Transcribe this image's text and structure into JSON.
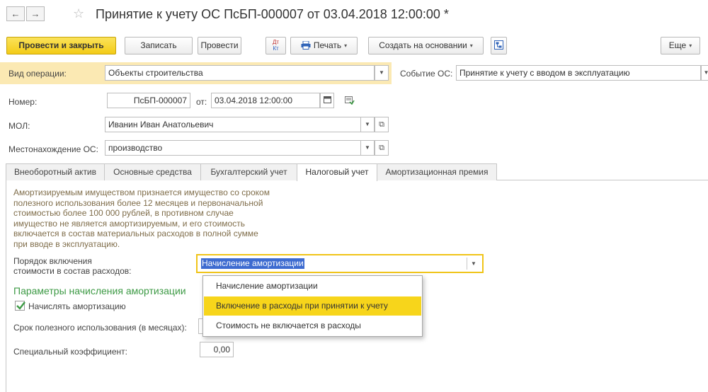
{
  "window": {
    "title": "Принятие к учету ОС ПсБП-000007 от 03.04.2018 12:00:00 *",
    "back_glyph": "←",
    "forward_glyph": "→",
    "star_glyph": "☆"
  },
  "toolbar": {
    "post_close": "Провести и закрыть",
    "save": "Записать",
    "post": "Провести",
    "dtkt_top": "Дт",
    "dtkt_bottom": "Кт",
    "print": "Печать",
    "create_based": "Создать на основании",
    "more": "Еще"
  },
  "form": {
    "operation_label": "Вид операции:",
    "operation_value": "Объекты строительства",
    "event_label": "Событие ОС:",
    "event_value": "Принятие к учету с вводом в эксплуатацию",
    "number_label": "Номер:",
    "number_value": "ПсБП-000007",
    "date_label": "от:",
    "date_value": "03.04.2018 12:00:00",
    "mol_label": "МОЛ:",
    "mol_value": "Иванин Иван Анатольевич",
    "location_label": "Местонахождение ОС:",
    "location_value": "производство"
  },
  "tabs": [
    {
      "label": "Внеоборотный актив"
    },
    {
      "label": "Основные средства"
    },
    {
      "label": "Бухгалтерский учет"
    },
    {
      "label": "Налоговый учет"
    },
    {
      "label": "Амортизационная премия"
    }
  ],
  "active_tab": "Налоговый учет",
  "tax": {
    "info_lines": [
      "Амортизируемым имуществом признается имущество со сроком",
      "полезного использования более 12 месяцев и первоначальной",
      "стоимостью более 100 000 рублей, в противном случае",
      "имущество не является амортизируемым, и его стоимость",
      "включается в состав материальных расходов в полной сумме",
      "при вводе в эксплуатацию."
    ],
    "order_label_1": "Порядок включения",
    "order_label_2": "стоимости в состав расходов:",
    "order_value": "Начисление амортизации",
    "section_title": "Параметры начисления амортизации",
    "accrue_label": "Начислять амортизацию",
    "accrue_checked": true,
    "useful_life_label": "Срок полезного использования (в месяцах):",
    "coef_label": "Специальный коэффициент:",
    "coef_value": "0,00"
  },
  "dropdown": {
    "options": [
      "Начисление амортизации",
      "Включение в расходы при принятии к учету",
      "Стоимость не включается в расходы"
    ],
    "highlighted_index": 1
  },
  "colors": {
    "primary_button": "#f3cb17",
    "highlight_band": "#fbe9b3",
    "section_green": "#3d9a45",
    "info_text": "#7f6d4a",
    "selection_blue": "#3d6bd0"
  }
}
